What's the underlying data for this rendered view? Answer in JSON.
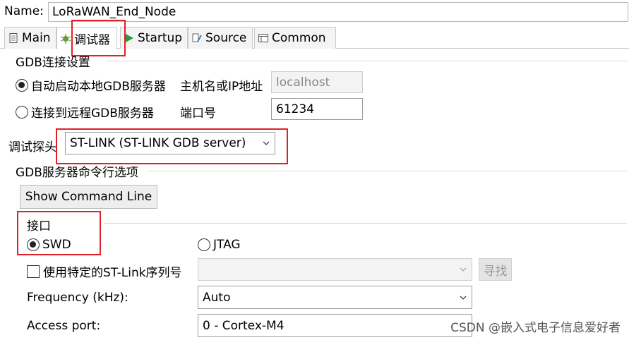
{
  "name_field": {
    "label": "Name:",
    "value": "LoRaWAN_End_Node"
  },
  "tabs": [
    {
      "label": "Main",
      "icon": "document-icon"
    },
    {
      "label": "调试器",
      "icon": "debugger-icon"
    },
    {
      "label": "Startup",
      "icon": "play-icon"
    },
    {
      "label": "Source",
      "icon": "source-icon"
    },
    {
      "label": "Common",
      "icon": "common-icon"
    }
  ],
  "gdb_connection": {
    "title": "GDB连接设置",
    "auto_start_label": "自动启动本地GDB服务器",
    "remote_label": "连接到远程GDB服务器",
    "host_label": "主机名或IP地址",
    "host_value": "localhost",
    "port_label": "端口号",
    "port_value": "61234"
  },
  "debug_probe": {
    "label": "调试探头",
    "value": "ST-LINK (ST-LINK GDB server)"
  },
  "gdb_server_options": {
    "title": "GDB服务器命令行选项",
    "show_cmd_button": "Show Command Line"
  },
  "interface": {
    "title": "接口",
    "swd_label": "SWD",
    "jtag_label": "JTAG"
  },
  "stlink_serial": {
    "label": "使用特定的ST-Link序列号",
    "value": "",
    "find_button": "寻找"
  },
  "frequency": {
    "label": "Frequency (kHz):",
    "value": "Auto"
  },
  "access_port": {
    "label": "Access port:",
    "value": "0 - Cortex-M4"
  },
  "watermark": "CSDN @嵌入式电子信息爱好者",
  "colors": {
    "highlight_box": "#e0202a"
  }
}
